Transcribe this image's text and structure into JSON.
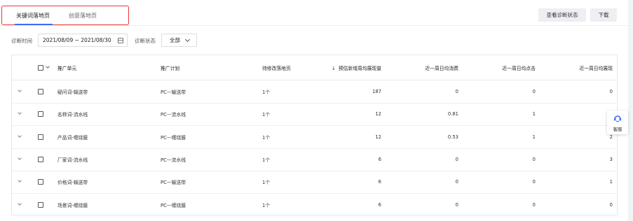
{
  "tabs": [
    {
      "label": "关键词落地页",
      "active": true
    },
    {
      "label": "创意落地页",
      "active": false
    }
  ],
  "actions": {
    "check_status": "查看诊断状态",
    "download": "下载"
  },
  "filters": {
    "time_label": "诊断时间",
    "date_range": "2021/08/09 ~ 2021/08/30",
    "status_label": "诊断状态",
    "status_value": "全部"
  },
  "table": {
    "headers": {
      "unit": "推广单元",
      "plan": "推广计划",
      "pending": "待修改落地页",
      "est_sort_arrow": "↓",
      "est": "预估新增周均展现量",
      "cost": "近一周日均消费",
      "click": "近一周日均点击",
      "impressions": "近一周日均展现"
    },
    "rows": [
      {
        "unit": "疑问词-输送带",
        "plan": "PC—输送带",
        "pending": "1个",
        "est": "187",
        "cost": "0",
        "click": "0",
        "impressions": "0"
      },
      {
        "unit": "名称词-流水线",
        "plan": "PC—流水线",
        "pending": "1个",
        "est": "12",
        "cost": "0.81",
        "click": "1",
        "impressions": "1"
      },
      {
        "unit": "产品词-缠绕膜",
        "plan": "PC—缠绕膜",
        "pending": "1个",
        "est": "12",
        "cost": "0.53",
        "click": "1",
        "impressions": "2"
      },
      {
        "unit": "厂家词-流水线",
        "plan": "PC—流水线",
        "pending": "1个",
        "est": "6",
        "cost": "0",
        "click": "0",
        "impressions": "3"
      },
      {
        "unit": "价格词-输送带",
        "plan": "PC—输送带",
        "pending": "1个",
        "est": "6",
        "cost": "0",
        "click": "0",
        "impressions": "1"
      },
      {
        "unit": "场景词-缠绕膜",
        "plan": "PC—缠绕膜",
        "pending": "1个",
        "est": "6",
        "cost": "0",
        "click": "0",
        "impressions": "0"
      }
    ]
  },
  "service": {
    "label": "客服",
    "icon": "headset-icon"
  },
  "colors": {
    "accent": "#3b6cf6",
    "highlight_border": "#e53935"
  }
}
